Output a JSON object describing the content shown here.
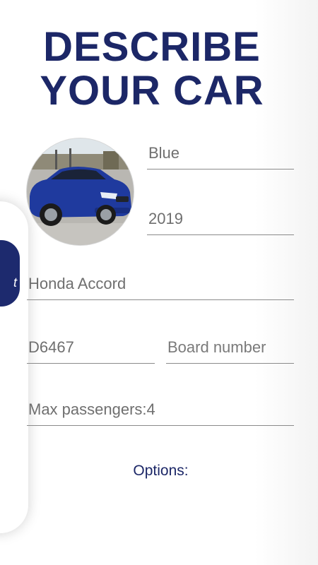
{
  "headline": {
    "line1": "DESCRIBE",
    "line2": "YOUR CAR"
  },
  "background_phone": {
    "tab_text": "t"
  },
  "form": {
    "color_value": "Blue",
    "year_value": "2019",
    "model_value": "Honda Accord",
    "plate_value": "D6467",
    "board_number_placeholder": "Board number",
    "max_passengers_value": "Max passengers:4"
  },
  "options": {
    "label": "Options:"
  },
  "colors": {
    "brand_navy": "#1c2767",
    "car_blue": "#1f3a9e"
  }
}
